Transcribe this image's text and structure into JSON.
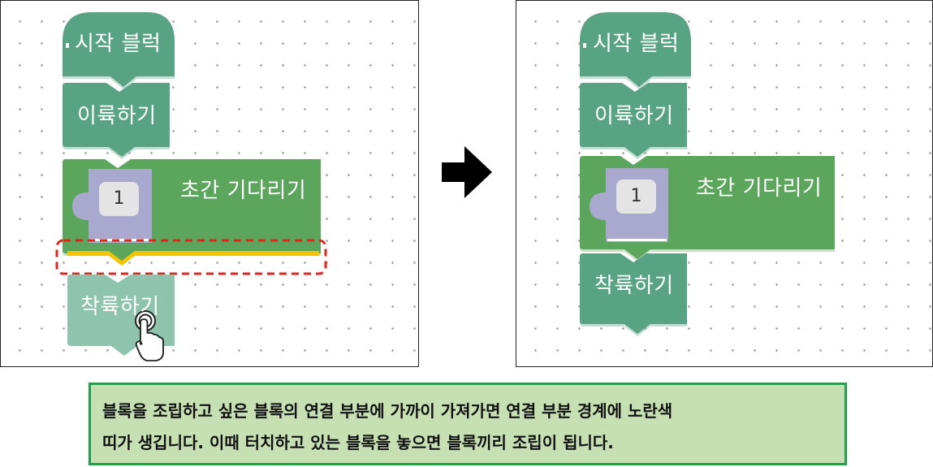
{
  "before": {
    "start_block_label": "시작 블럭",
    "takeoff_block_label": "이륙하기",
    "wait_block_label": "초간 기다리기",
    "wait_value": "1",
    "land_block_label": "착륙하기"
  },
  "after": {
    "start_block_label": "시작 블럭",
    "takeoff_block_label": "이륙하기",
    "wait_block_label": "초간 기다리기",
    "wait_value": "1",
    "land_block_label": "착륙하기"
  },
  "arrow_icon": "right-arrow-icon",
  "pointer_icon": "hand-pointer-icon",
  "caption": {
    "line1": "블록을 조립하고 싶은 블록의 연결 부분에 가까이 가져가면 연결 부분 경계에 노란색",
    "line2": "띠가 생깁니다. 이때 터치하고 있는 블록을 놓으면 블록끼리 조립이 됩니다."
  },
  "colors": {
    "teal_block": "#58a383",
    "green_block": "#5ba55b",
    "slot": "#a9a9cf",
    "highlight": "#f5c400",
    "dashed": "#e0261b",
    "caption_bg": "#c6e0b4",
    "caption_border": "#1fa04a"
  }
}
